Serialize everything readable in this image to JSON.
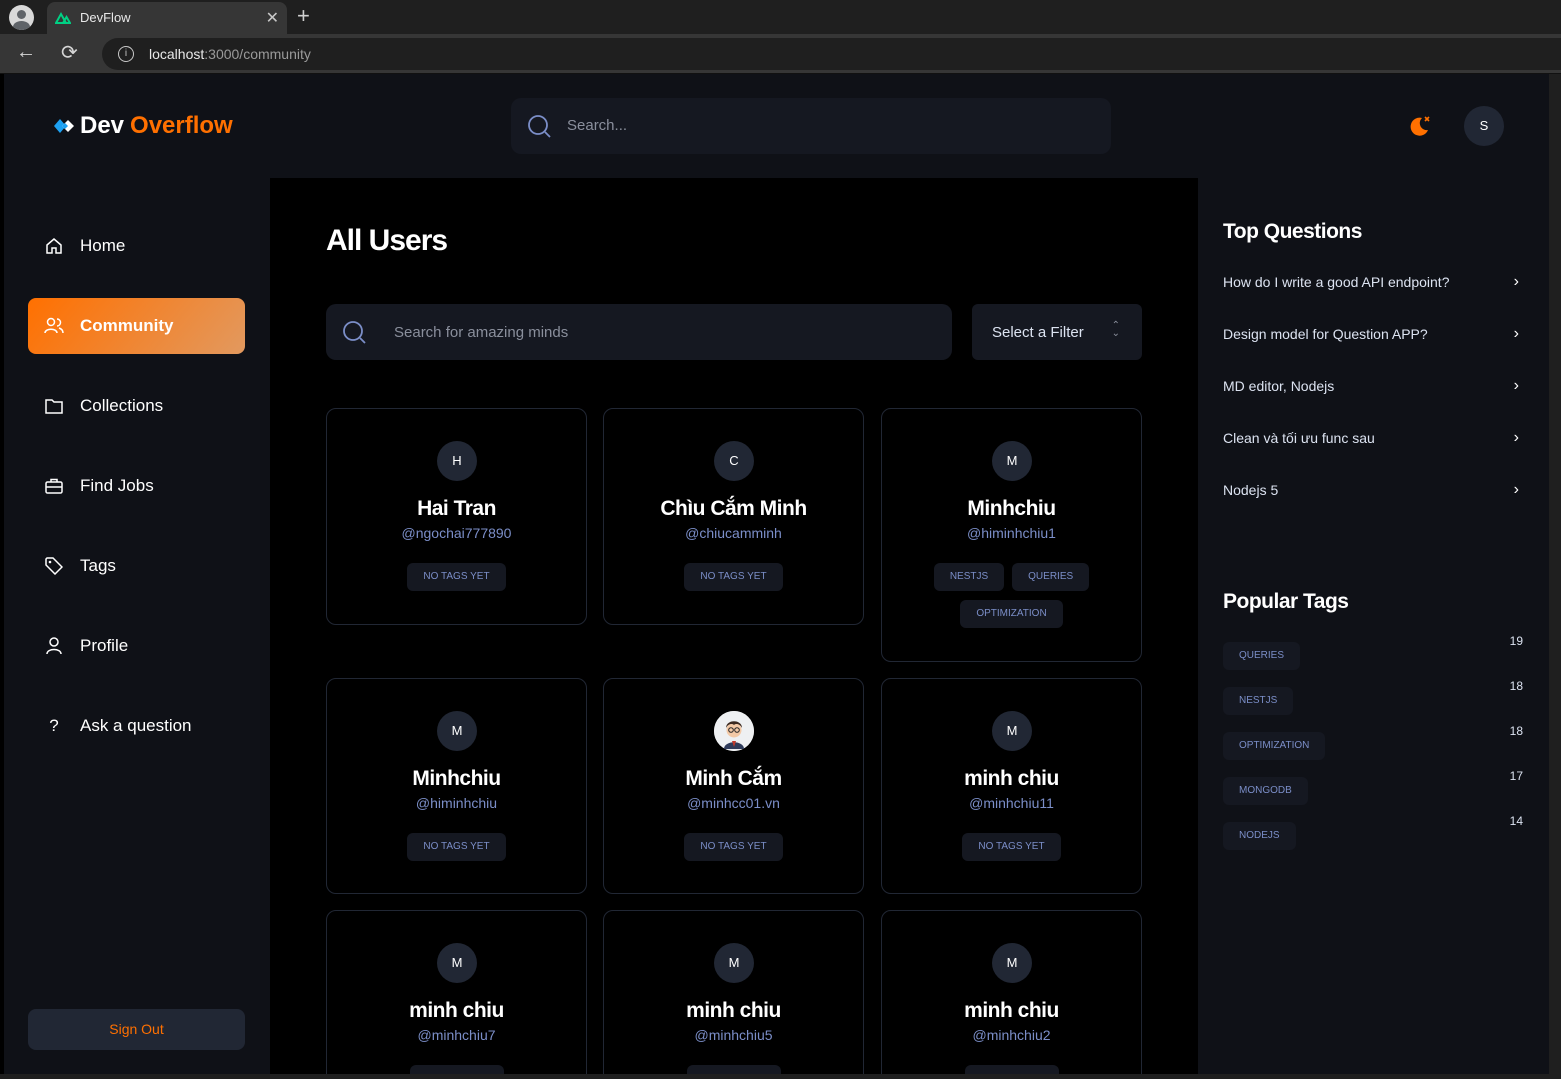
{
  "browser": {
    "tab_title": "DevFlow",
    "url_host": "localhost",
    "url_path": ":3000/community"
  },
  "header": {
    "logo_dev": "Dev",
    "logo_overflow": "Overflow",
    "search_placeholder": "Search...",
    "avatar_initial": "S",
    "brand_color": "#ff7000"
  },
  "sidebar": {
    "items": [
      {
        "label": "Home",
        "icon": "home-icon"
      },
      {
        "label": "Community",
        "icon": "users-icon",
        "active": true
      },
      {
        "label": "Collections",
        "icon": "folder-icon"
      },
      {
        "label": "Find Jobs",
        "icon": "briefcase-icon"
      },
      {
        "label": "Tags",
        "icon": "tag-icon"
      },
      {
        "label": "Profile",
        "icon": "user-icon"
      },
      {
        "label": "Ask a question",
        "icon": "question-icon"
      }
    ],
    "signout_label": "Sign Out"
  },
  "main": {
    "title": "All Users",
    "search_placeholder": "Search for amazing minds",
    "filter_label": "Select a Filter",
    "users": [
      {
        "initial": "H",
        "name": "Hai Tran",
        "handle": "@ngochai777890",
        "tags": [
          "NO TAGS YET"
        ]
      },
      {
        "initial": "C",
        "name": "Chìu Cắm Minh",
        "handle": "@chiucamminh",
        "tags": [
          "NO TAGS YET"
        ]
      },
      {
        "initial": "M",
        "name": "Minhchiu",
        "handle": "@himinhchiu1",
        "tags": [
          "NESTJS",
          "QUERIES",
          "OPTIMIZATION"
        ]
      },
      {
        "initial": "M",
        "name": "Minhchiu",
        "handle": "@himinhchiu",
        "tags": [
          "NO TAGS YET"
        ]
      },
      {
        "initial": "",
        "name": "Minh Cắm",
        "handle": "@minhcc01.vn",
        "tags": [
          "NO TAGS YET"
        ],
        "photo": true
      },
      {
        "initial": "M",
        "name": "minh chiu",
        "handle": "@minhchiu11",
        "tags": [
          "NO TAGS YET"
        ]
      },
      {
        "initial": "M",
        "name": "minh chiu",
        "handle": "@minhchiu7",
        "tags": []
      },
      {
        "initial": "M",
        "name": "minh chiu",
        "handle": "@minhchiu5",
        "tags": []
      },
      {
        "initial": "M",
        "name": "minh chiu",
        "handle": "@minhchiu2",
        "tags": []
      }
    ]
  },
  "right": {
    "top_questions_title": "Top Questions",
    "top_questions": [
      "How do I write a good API endpoint?",
      "Design model for Question APP?",
      "MD editor, Nodejs",
      "Clean và tối ưu func sau",
      "Nodejs 5"
    ],
    "popular_tags_title": "Popular Tags",
    "popular_tags": [
      {
        "name": "QUERIES",
        "count": "19"
      },
      {
        "name": "NESTJS",
        "count": "18"
      },
      {
        "name": "OPTIMIZATION",
        "count": "18"
      },
      {
        "name": "MONGODB",
        "count": "17"
      },
      {
        "name": "NODEJS",
        "count": "14"
      }
    ]
  }
}
